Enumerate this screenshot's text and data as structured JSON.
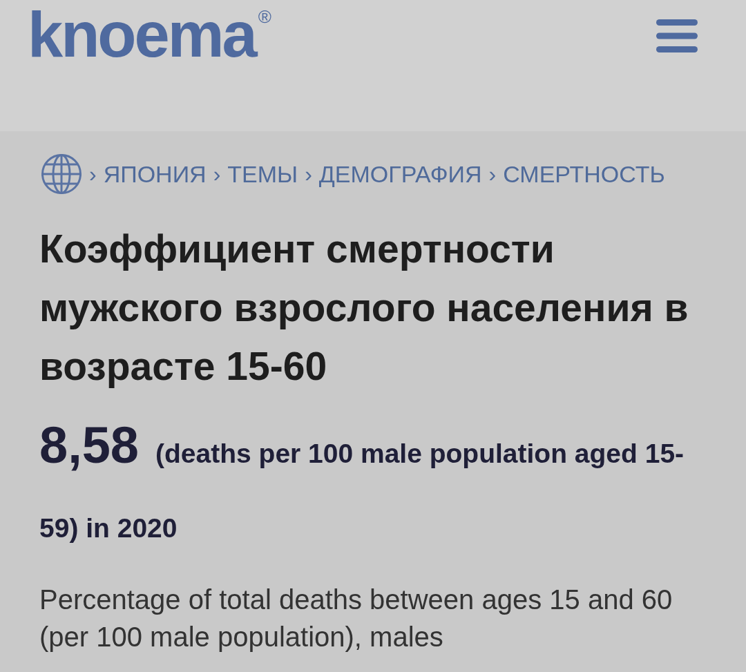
{
  "header": {
    "logo": "knoema$^{®}$"
  },
  "breadcrumb": [
    {
      "separator": "›",
      "label": "ЯПОНИЯ"
    },
    {
      "separator": "›",
      "label": "ТЕМЫ"
    },
    {
      "separator": "›",
      "label": "ДЕМОГРАФИЯ"
    },
    {
      "separator": "›",
      "label": "СМЕРТНОСТЬ"
    }
  ],
  "title": "Коэффициент смертности мужского взрослого населения в возрасте 15-60",
  "indicator": {
    "value": "8,58",
    "unit": "(deaths per 100 male population aged 15-59) in 2020"
  },
  "description": "Percentage of total deaths between ages 15 and 60 (per 100 male population), males"
}
